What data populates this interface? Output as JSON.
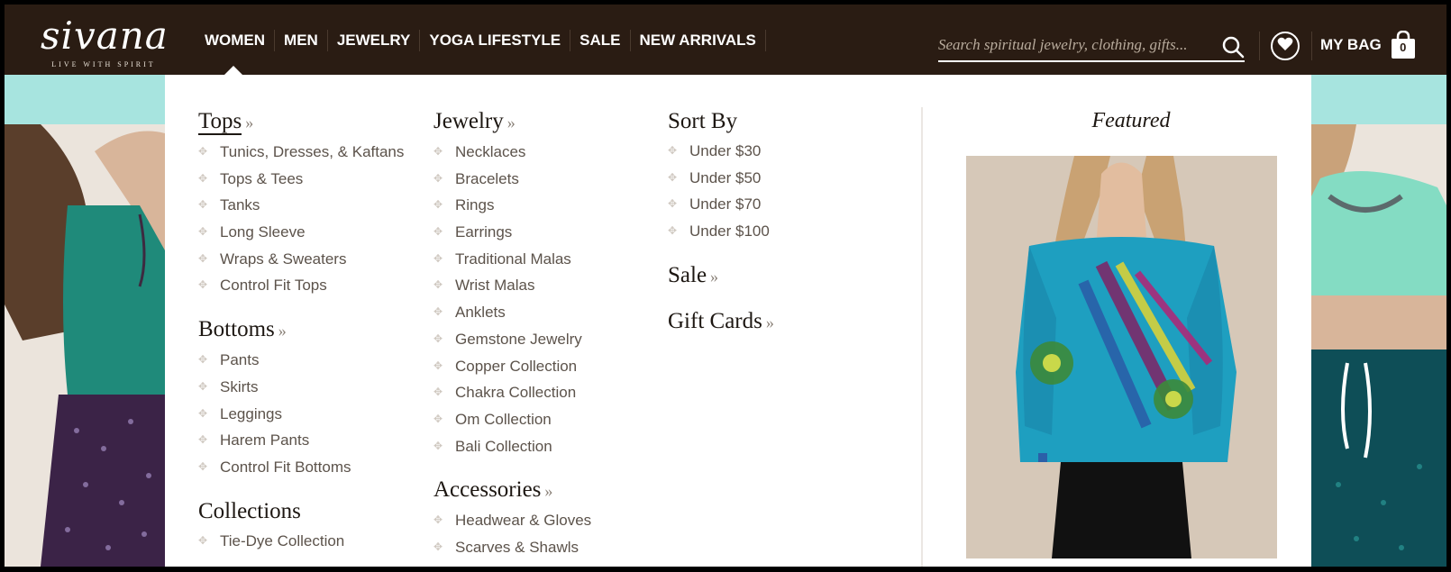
{
  "brand": {
    "name": "sivana",
    "tagline": "LIVE WITH SPIRIT"
  },
  "nav": {
    "items": [
      "WOMEN",
      "MEN",
      "JEWELRY",
      "YOGA LIFESTYLE",
      "SALE",
      "NEW ARRIVALS"
    ],
    "active": "WOMEN"
  },
  "search": {
    "placeholder": "Search spiritual jewelry, clothing, gifts..."
  },
  "bag": {
    "label": "MY BAG",
    "count": "0"
  },
  "menu": {
    "tops": {
      "heading": "Tops",
      "items": [
        "Tunics, Dresses, & Kaftans",
        "Tops & Tees",
        "Tanks",
        "Long Sleeve",
        "Wraps & Sweaters",
        "Control Fit Tops"
      ]
    },
    "bottoms": {
      "heading": "Bottoms",
      "items": [
        "Pants",
        "Skirts",
        "Leggings",
        "Harem Pants",
        "Control Fit Bottoms"
      ]
    },
    "collections": {
      "heading": "Collections",
      "items": [
        "Tie-Dye Collection"
      ]
    },
    "jewelry": {
      "heading": "Jewelry",
      "items": [
        "Necklaces",
        "Bracelets",
        "Rings",
        "Earrings",
        "Traditional Malas",
        "Wrist Malas",
        "Anklets",
        "Gemstone Jewelry",
        "Copper Collection",
        "Chakra Collection",
        "Om Collection",
        "Bali Collection"
      ]
    },
    "accessories": {
      "heading": "Accessories",
      "items": [
        "Headwear & Gloves",
        "Scarves & Shawls"
      ]
    },
    "sort_by": {
      "heading": "Sort By",
      "items": [
        "Under $30",
        "Under $50",
        "Under $70",
        "Under $100"
      ]
    },
    "sale": {
      "heading": "Sale"
    },
    "gift_cards": {
      "heading": "Gift Cards"
    },
    "featured": {
      "title": "Featured"
    }
  },
  "colors": {
    "header_bg": "#2a1c13",
    "accent_teal": "#a7e4df",
    "text_dark": "#1d1712",
    "text_muted": "#5c534b"
  }
}
